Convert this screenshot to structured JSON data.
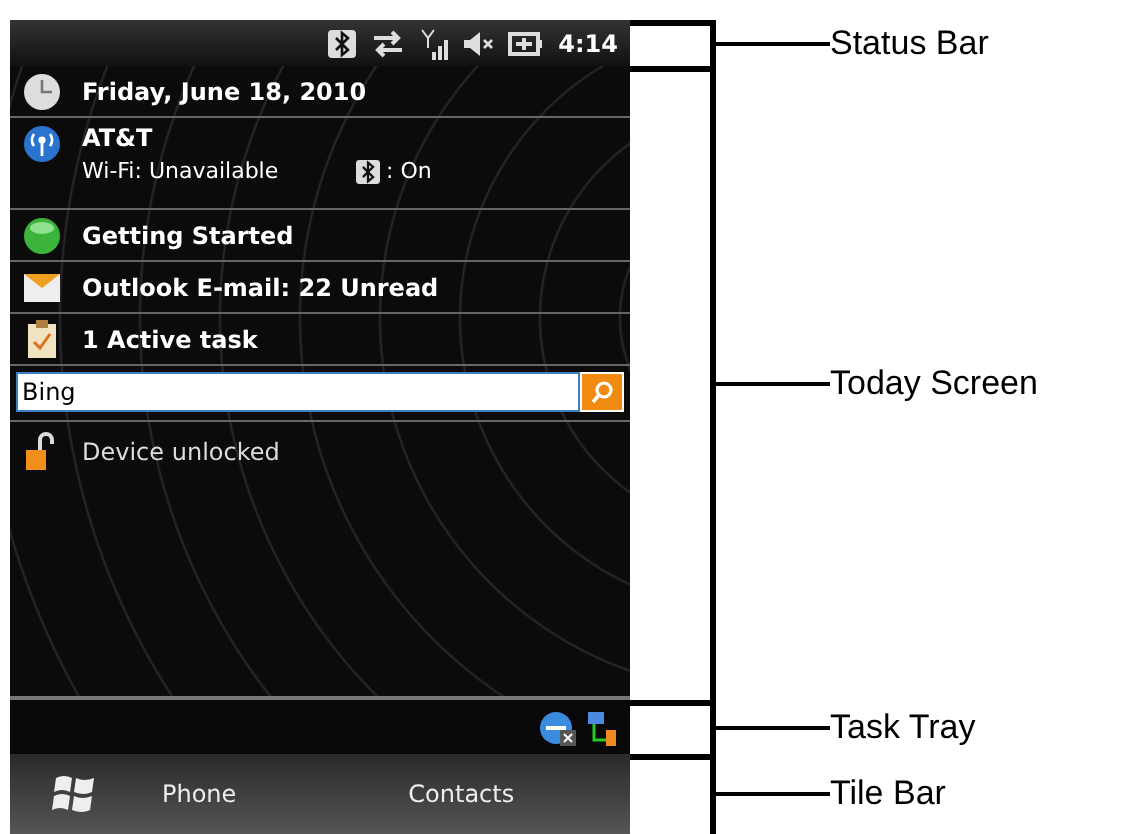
{
  "status_bar": {
    "time": "4:14"
  },
  "today_items": [
    {
      "kind": "date",
      "title": "Friday, June 18, 2010"
    },
    {
      "kind": "network",
      "title": "AT&T",
      "detail": "Wi-Fi: Unavailable",
      "bluetooth_status": ": On"
    },
    {
      "kind": "getting_started",
      "title": "Getting Started"
    },
    {
      "kind": "email",
      "title": "Outlook E-mail: 22 Unread"
    },
    {
      "kind": "tasks",
      "title": "1 Active task"
    }
  ],
  "search": {
    "value": "Bing"
  },
  "lock": {
    "text": "Device unlocked"
  },
  "tile_bar": {
    "left": "Phone",
    "right": "Contacts"
  },
  "callouts": [
    "Status Bar",
    "Today Screen",
    "Task Tray",
    "Tile Bar"
  ]
}
